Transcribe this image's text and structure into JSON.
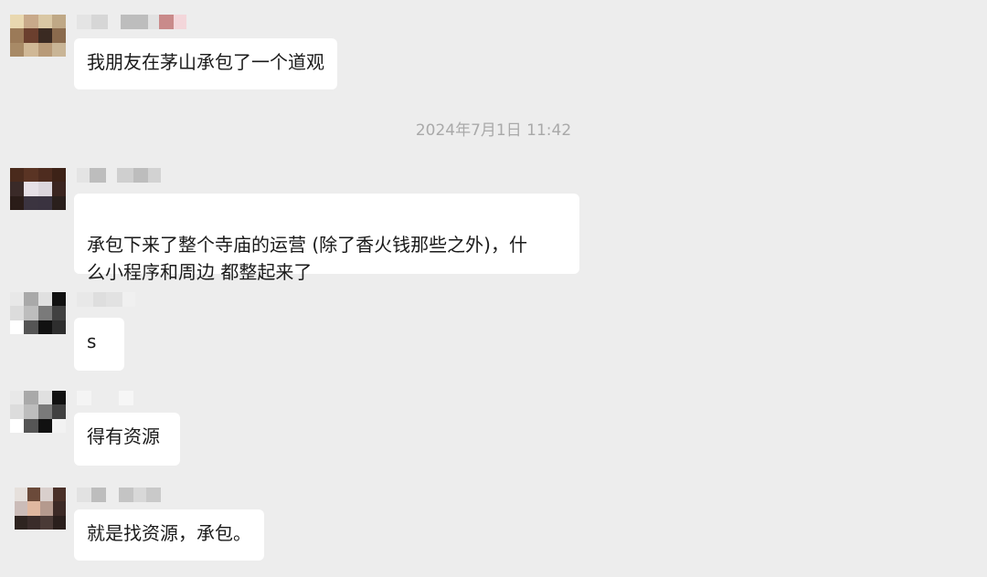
{
  "timestamp": "2024年7月1日 11:42",
  "messages": [
    {
      "text": "我朋友在茅山承包了一个道观"
    },
    {
      "text": "承包下来了整个寺庙的运营 (除了香火钱那些之外)，什\n么小程序和周边 都整起来了"
    },
    {
      "text": "s"
    },
    {
      "text": "得有资源"
    },
    {
      "text": "就是找资源，承包。"
    }
  ],
  "colors": {
    "background": "#ededed",
    "bubble": "#ffffff",
    "timestamp": "#a9a9a9"
  }
}
